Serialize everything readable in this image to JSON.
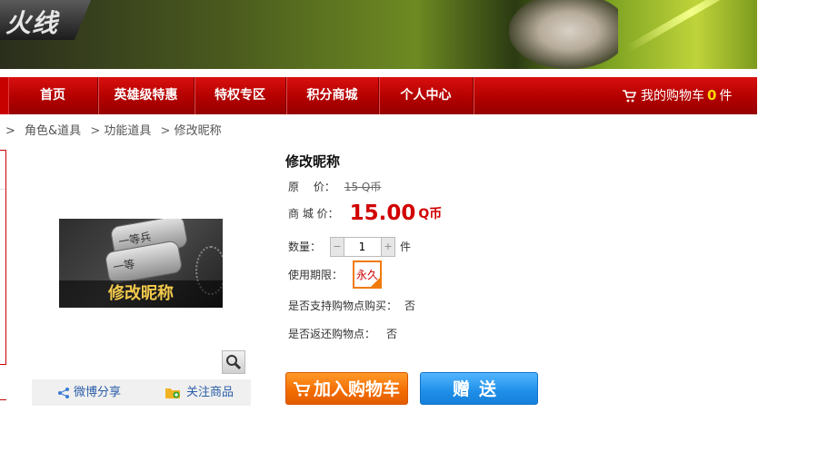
{
  "banner": {
    "logo_text": "火线"
  },
  "nav": {
    "items": [
      "首页",
      "英雄级特惠",
      "特权专区",
      "积分商城",
      "个人中心"
    ],
    "cart": {
      "label": "我的购物车",
      "count": "0",
      "unit": "件"
    }
  },
  "breadcrumb": [
    ">",
    "角色&道具",
    ">",
    "功能道具",
    ">",
    "修改昵称"
  ],
  "product": {
    "image_caption": "修改昵称",
    "tag_text_1": "一等兵",
    "tag_text_2": "一等",
    "title": "修改昵称",
    "original_price_label": "原　 价：",
    "original_price": "15 Q币",
    "shop_price_label": "商 城 价：",
    "shop_price": "15.00",
    "shop_price_unit": "Q币",
    "quantity_label": "数量：",
    "quantity_value": "1",
    "quantity_unit": "件",
    "stepper_minus": "−",
    "stepper_plus": "+",
    "validity_label": "使用期限：",
    "validity_option": "永久",
    "support_points_label": "是否支持购物点购买：",
    "support_points_value": "否",
    "return_points_label": "是否返还购物点：",
    "return_points_value": "否"
  },
  "share": {
    "weibo": "微博分享",
    "follow": "关注商品"
  },
  "actions": {
    "add_to_cart": "加入购物车",
    "gift": "赠送"
  }
}
